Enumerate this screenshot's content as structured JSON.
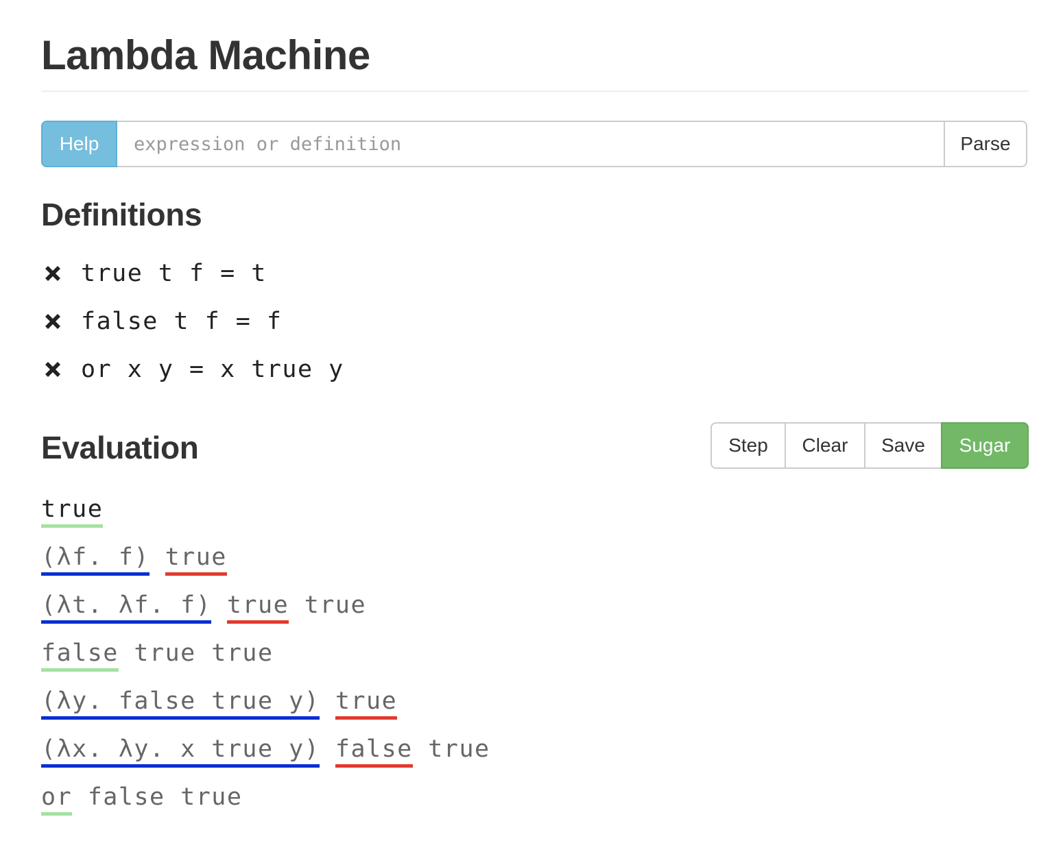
{
  "app": {
    "title": "Lambda Machine"
  },
  "input_bar": {
    "help_label": "Help",
    "placeholder": "expression or definition",
    "value": "",
    "parse_label": "Parse"
  },
  "definitions": {
    "heading": "Definitions",
    "items": [
      {
        "icon": "remove-icon",
        "text": "true t f = t"
      },
      {
        "icon": "remove-icon",
        "text": "false t f = f"
      },
      {
        "icon": "remove-icon",
        "text": "or x y = x true y"
      }
    ]
  },
  "evaluation": {
    "heading": "Evaluation",
    "buttons": {
      "step": "Step",
      "clear": "Clear",
      "save": "Save",
      "sugar": "Sugar"
    },
    "colors": {
      "sugar_active": "#72b866",
      "underline_green": "#a3e2a0",
      "underline_blue": "#0b2fd3",
      "underline_red": "#e23a2e",
      "help_button": "#76bede"
    },
    "steps": [
      {
        "tokens": [
          {
            "text": "true",
            "mark": "green"
          }
        ]
      },
      {
        "tokens": [
          {
            "text": "(λf. f)",
            "mark": "blue"
          },
          {
            "text": " ",
            "mark": ""
          },
          {
            "text": "true",
            "mark": "red"
          }
        ]
      },
      {
        "tokens": [
          {
            "text": "(λt. λf. f)",
            "mark": "blue"
          },
          {
            "text": " ",
            "mark": ""
          },
          {
            "text": "true",
            "mark": "red"
          },
          {
            "text": " true",
            "mark": ""
          }
        ]
      },
      {
        "tokens": [
          {
            "text": "false",
            "mark": "green"
          },
          {
            "text": " true true",
            "mark": ""
          }
        ]
      },
      {
        "tokens": [
          {
            "text": "(λy. false true y)",
            "mark": "blue"
          },
          {
            "text": " ",
            "mark": ""
          },
          {
            "text": "true",
            "mark": "red"
          }
        ]
      },
      {
        "tokens": [
          {
            "text": "(λx. λy. x true y)",
            "mark": "blue"
          },
          {
            "text": " ",
            "mark": ""
          },
          {
            "text": "false",
            "mark": "red"
          },
          {
            "text": " true",
            "mark": ""
          }
        ]
      },
      {
        "tokens": [
          {
            "text": "or",
            "mark": "green"
          },
          {
            "text": " false true",
            "mark": ""
          }
        ]
      }
    ]
  }
}
